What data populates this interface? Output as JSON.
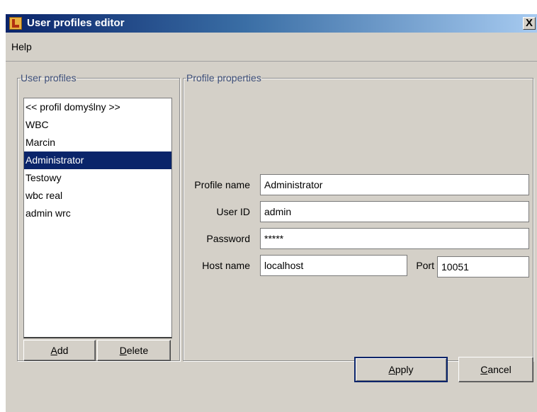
{
  "window": {
    "title": "User profiles editor",
    "close_glyph": "X",
    "icon": "app-icon"
  },
  "menu": {
    "items": [
      {
        "label": "Help"
      }
    ]
  },
  "profiles": {
    "legend": "User profiles",
    "items": [
      {
        "label": "<< profil domyślny >>",
        "selected": false
      },
      {
        "label": "WBC",
        "selected": false
      },
      {
        "label": "Marcin",
        "selected": false
      },
      {
        "label": "Administrator",
        "selected": true
      },
      {
        "label": "Testowy",
        "selected": false
      },
      {
        "label": "wbc real",
        "selected": false
      },
      {
        "label": "admin wrc",
        "selected": false
      }
    ],
    "add_label": "Add",
    "add_mnemonic": "A",
    "delete_label": "Delete",
    "delete_mnemonic": "D"
  },
  "properties": {
    "legend": "Profile properties",
    "profile_name_label": "Profile name",
    "profile_name_value": "Administrator",
    "user_id_label": "User ID",
    "user_id_value": "admin",
    "password_label": "Password",
    "password_value": "*****",
    "host_name_label": "Host name",
    "host_name_value": "localhost",
    "port_label": "Port",
    "port_value": "10051"
  },
  "actions": {
    "apply_label": "Apply",
    "apply_mnemonic": "A",
    "cancel_label": "Cancel",
    "cancel_mnemonic": "C"
  },
  "colors": {
    "selection": "#0a246a",
    "legend_text": "#3d4f7a",
    "window_bg": "#d4d0c8"
  }
}
